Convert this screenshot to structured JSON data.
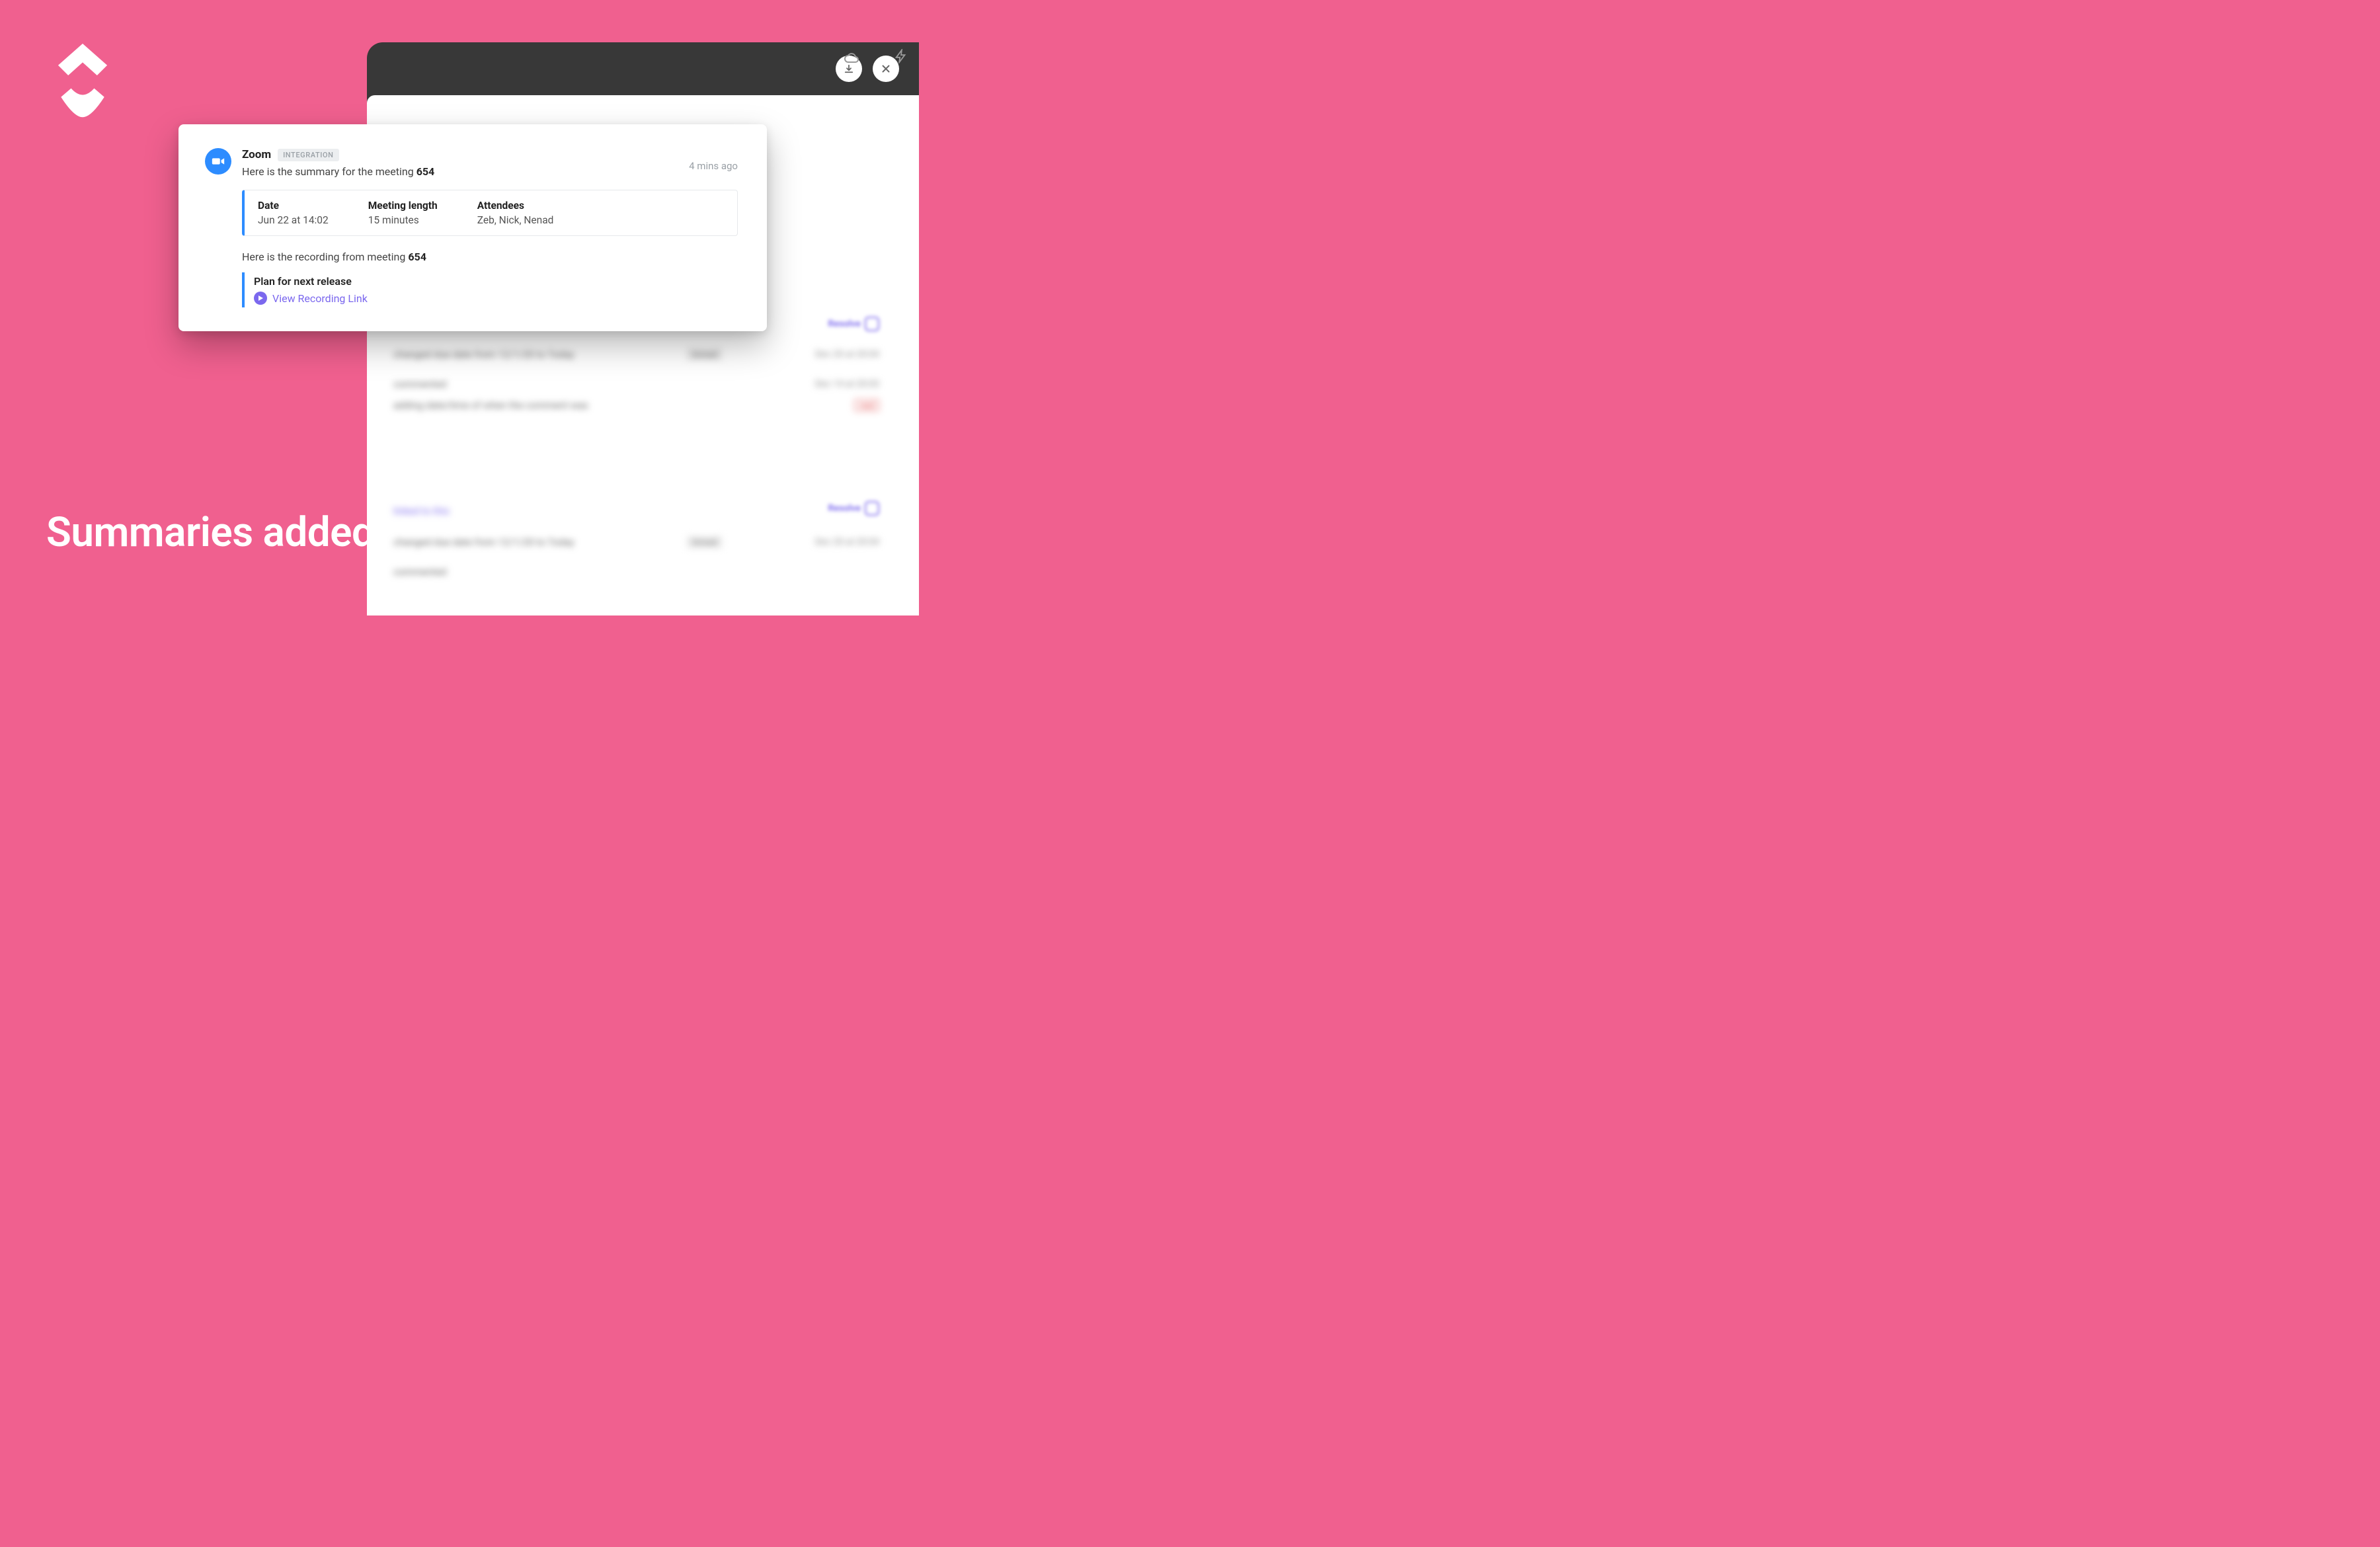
{
  "headline": "Summaries added to tasks automatically.",
  "titlebar": {
    "download": "download",
    "close": "close"
  },
  "zoom_card": {
    "app_name": "Zoom",
    "badge": "INTEGRATION",
    "summary_prefix": "Here is the summary for the meeting ",
    "meeting_id_1": "654",
    "timestamp": "4 mins ago",
    "columns": {
      "date_label": "Date",
      "date_value": "Jun 22 at 14:02",
      "length_label": "Meeting length",
      "length_value": "15 minutes",
      "attendees_label": "Attendees",
      "attendees_value": "Zeb, Nick, Nenad"
    },
    "recording_prefix": "Here is the recording from meeting ",
    "meeting_id_2": "654",
    "plan_title": "Plan for next release",
    "recording_link_text": "View Recording Link"
  },
  "feed": {
    "resolve_label": "Resolve",
    "row1_text": "changed due date from 12/1/20 to Today",
    "row1_pill": "Unread",
    "row1_date": "Dec 20 at 20:04",
    "row2_text": "commented",
    "row2_date": "Dec 14 at 20:03",
    "row3_text": "adding date/time of when the comment was",
    "row3_tag": "read",
    "row4_link": "linked to this",
    "row5_text": "changed due date from 12/1/20 to Today",
    "row5_pill": "Unread",
    "row5_date": "Dec 20 at 20:04",
    "row6_text": "commented"
  }
}
